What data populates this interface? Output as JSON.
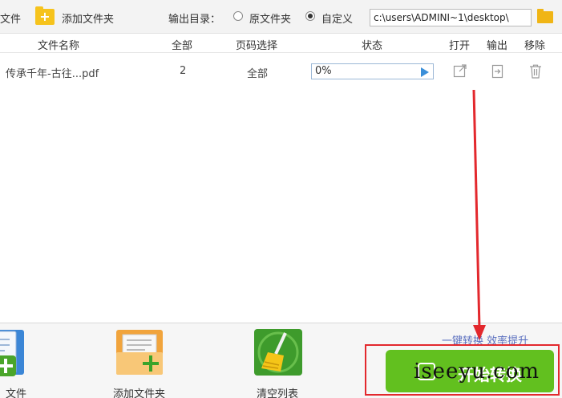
{
  "toolbar": {
    "add_file_label": "文件",
    "add_folder_label": "添加文件夹",
    "output_dir_label": "输出目录：",
    "radio_original": "原文件夹",
    "radio_custom": "自定义",
    "output_path": "c:\\users\\ADMINI~1\\desktop\\"
  },
  "table": {
    "headers": [
      "文件名称",
      "全部",
      "页码选择",
      "状态",
      "打开",
      "输出",
      "移除"
    ],
    "rows": [
      {
        "file_name": "传承千年-古往...pdf",
        "pages": "2",
        "page_select": "全部",
        "progress": "0%"
      }
    ]
  },
  "bottom": {
    "add_file_label": "文件",
    "add_folder_label": "添加文件夹",
    "clear_list_label": "清空列表",
    "slogan": "一键转换  效率提升",
    "start_button_label": "开始转换",
    "watermark": "iseeyu.com"
  },
  "colors": {
    "accent_green": "#62c01f",
    "highlight_red": "#e3282d",
    "folder_yellow": "#f6c31c",
    "progress_blue": "#3a8fd9"
  }
}
